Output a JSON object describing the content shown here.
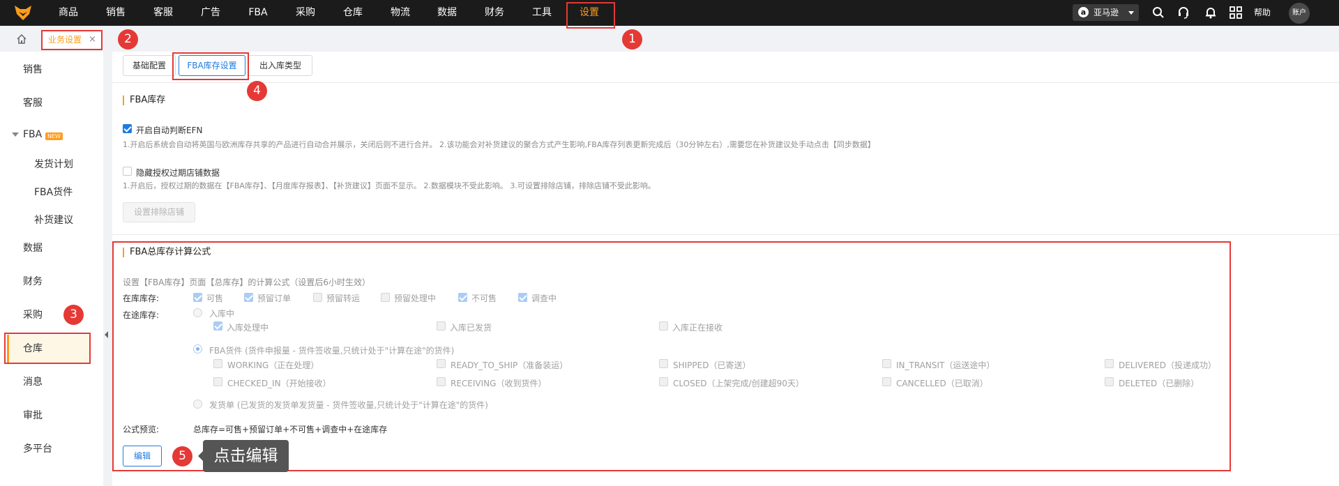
{
  "topnav": {
    "items": [
      "商品",
      "销售",
      "客服",
      "广告",
      "FBA",
      "采购",
      "仓库",
      "物流",
      "数据",
      "财务",
      "工具",
      "设置"
    ],
    "active": "设置",
    "store": "亚马逊",
    "help": "帮助",
    "account": "账户"
  },
  "tabs": {
    "current": "业务设置",
    "close": "×"
  },
  "sidebar": {
    "items": [
      "销售",
      "客服",
      "FBA",
      "数据",
      "财务",
      "采购",
      "仓库",
      "消息",
      "审批",
      "多平台"
    ],
    "fba_badge": "NEW",
    "fba_children": [
      "发货计划",
      "FBA货件",
      "补货建议"
    ],
    "active": "仓库"
  },
  "subtabs": [
    "基础配置",
    "FBA库存设置",
    "出入库类型"
  ],
  "fba_inventory": {
    "title": "FBA库存",
    "efn_label": "开启自动判断EFN",
    "efn_checked": true,
    "efn_desc": "1.开启后系统会自动将英国与欧洲库存共享的产品进行自动合并展示，关闭后则不进行合并。 2.该功能会对补货建议的聚合方式产生影响,FBA库存列表更新完成后（30分钟左右）,需要您在补货建议处手动点击【同步数据】",
    "hide_label": "隐藏授权过期店铺数据",
    "hide_checked": false,
    "hide_desc": "1.开启后，授权过期的数据在【FBA库存】、【月度库存报表】、【补货建议】页面不显示。 2.数据模块不受此影响。 3.可设置排除店铺，排除店铺不受此影响。",
    "exclude_button": "设置排除店铺"
  },
  "formula": {
    "title": "FBA总库存计算公式",
    "desc": "设置【FBA库存】页面【总库存】的计算公式（设置后6小时生效）",
    "instock_label": "在库库存:",
    "instock_options": [
      {
        "label": "可售",
        "checked": true
      },
      {
        "label": "预留订单",
        "checked": true
      },
      {
        "label": "预留转运",
        "checked": false
      },
      {
        "label": "预留处理中",
        "checked": false
      },
      {
        "label": "不可售",
        "checked": true
      },
      {
        "label": "调查中",
        "checked": true
      }
    ],
    "transit_label": "在途库存:",
    "inbound_label": "入库中",
    "inbound_options": [
      {
        "label": "入库处理中",
        "checked": true
      },
      {
        "label": "入库已发货",
        "checked": false
      },
      {
        "label": "入库正在接收",
        "checked": false
      }
    ],
    "shipment_label": "FBA货件 (货件申报量 - 货件签收量,只统计处于\"计算在途\"的货件)",
    "shipment_row1": [
      "WORKING（正在处理）",
      "READY_TO_SHIP（准备装运）",
      "SHIPPED（已寄送）",
      "IN_TRANSIT（运送途中）",
      "DELIVERED（投递成功）"
    ],
    "shipment_row2": [
      "CHECKED_IN（开始接收）",
      "RECEIVING（收到货件）",
      "CLOSED（上架完成/创建超90天）",
      "CANCELLED（已取消）",
      "DELETED（已删除）"
    ],
    "delivery_label": "发货单 (已发货的发货单发货量 - 货件签收量,只统计处于\"计算在途\"的货件)",
    "preview_label": "公式预览:",
    "preview_value": "总库存=可售+预留订单+不可售+调查中+在途库存",
    "edit_button": "编辑"
  },
  "annotations": {
    "numbers": [
      "1",
      "2",
      "3",
      "4",
      "5"
    ],
    "tooltip": "点击编辑"
  }
}
